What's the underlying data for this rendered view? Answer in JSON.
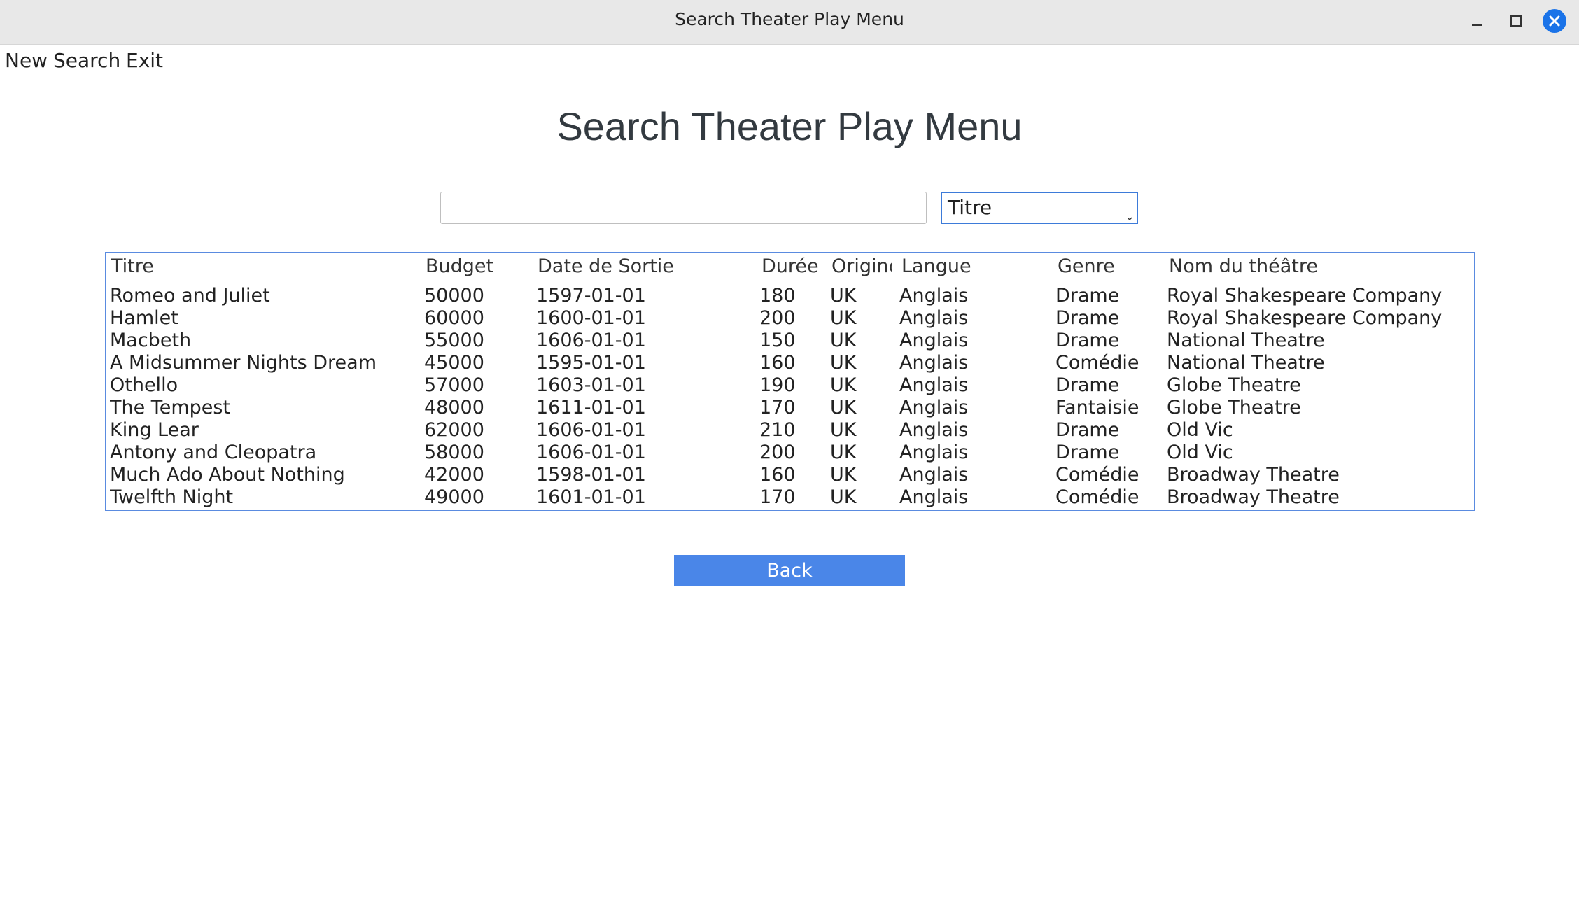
{
  "window": {
    "title": "Search Theater Play Menu",
    "controls": {
      "minimize_icon": "minimize-icon",
      "maximize_icon": "maximize-icon",
      "close_icon": "close-icon",
      "close_color": "#1a73e8"
    }
  },
  "menubar": {
    "items": [
      {
        "label": "New"
      },
      {
        "label": "Search"
      },
      {
        "label": "Exit"
      }
    ]
  },
  "page": {
    "heading": "Search Theater Play Menu"
  },
  "search": {
    "query_value": "",
    "placeholder": "",
    "field_selected": "Titre"
  },
  "table": {
    "columns": [
      "Titre",
      "Budget",
      "Date de Sortie",
      "Durée",
      "Origine",
      "Langue",
      "Genre",
      "Nom du théâtre"
    ],
    "rows": [
      [
        "Romeo and Juliet",
        "50000",
        "1597-01-01",
        "180",
        "UK",
        "Anglais",
        "Drame",
        "Royal Shakespeare Company"
      ],
      [
        "Hamlet",
        "60000",
        "1600-01-01",
        "200",
        "UK",
        "Anglais",
        "Drame",
        "Royal Shakespeare Company"
      ],
      [
        "Macbeth",
        "55000",
        "1606-01-01",
        "150",
        "UK",
        "Anglais",
        "Drame",
        "National Theatre"
      ],
      [
        "A Midsummer Nights Dream",
        "45000",
        "1595-01-01",
        "160",
        "UK",
        "Anglais",
        "Comédie",
        "National Theatre"
      ],
      [
        "Othello",
        "57000",
        "1603-01-01",
        "190",
        "UK",
        "Anglais",
        "Drame",
        "Globe Theatre"
      ],
      [
        "The Tempest",
        "48000",
        "1611-01-01",
        "170",
        "UK",
        "Anglais",
        "Fantaisie",
        "Globe Theatre"
      ],
      [
        "King Lear",
        "62000",
        "1606-01-01",
        "210",
        "UK",
        "Anglais",
        "Drame",
        "Old Vic"
      ],
      [
        "Antony and Cleopatra",
        "58000",
        "1606-01-01",
        "200",
        "UK",
        "Anglais",
        "Drame",
        "Old Vic"
      ],
      [
        "Much Ado About Nothing",
        "42000",
        "1598-01-01",
        "160",
        "UK",
        "Anglais",
        "Comédie",
        "Broadway Theatre"
      ],
      [
        "Twelfth Night",
        "49000",
        "1601-01-01",
        "170",
        "UK",
        "Anglais",
        "Comédie",
        "Broadway Theatre"
      ]
    ]
  },
  "actions": {
    "back_label": "Back",
    "accent_color": "#4a86e8"
  }
}
